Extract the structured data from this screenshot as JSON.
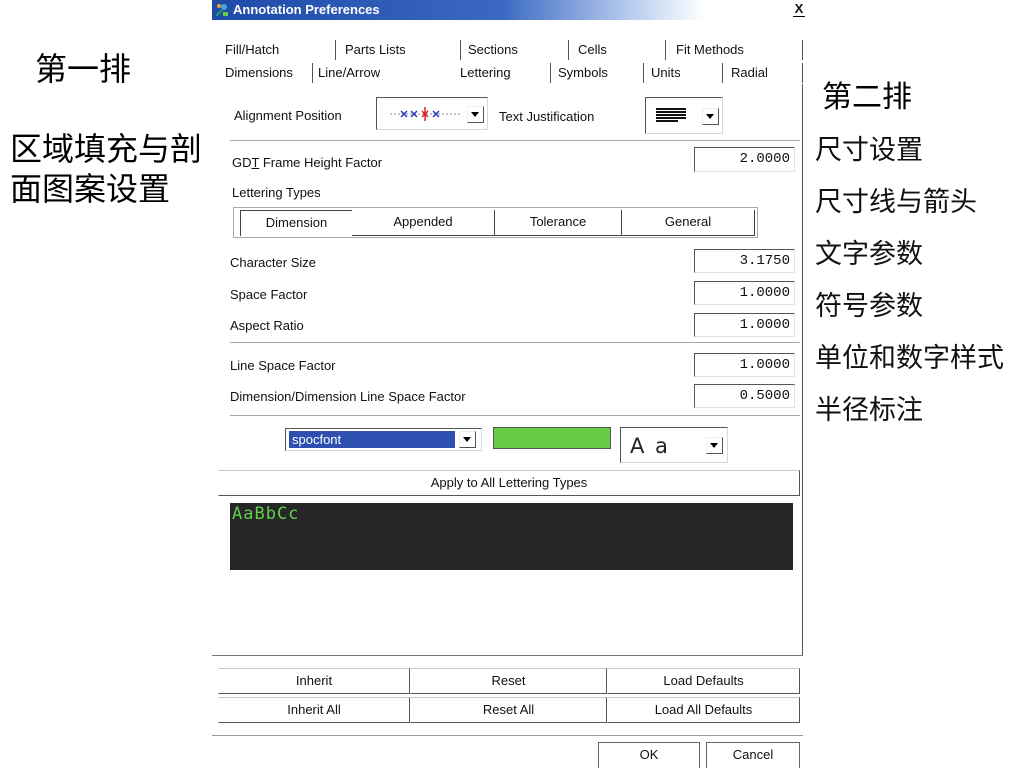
{
  "annotations": {
    "row1": "第一排",
    "fill_hatch": [
      "区域填充与剖",
      "面图案设置"
    ],
    "row2": "第二排",
    "row2_items": [
      "尺寸设置",
      "尺寸线与箭头",
      "文字参数",
      "符号参数",
      "单位和数字样式",
      "半径标注"
    ]
  },
  "window": {
    "title": "Annotation Preferences",
    "icon": "annotation-preferences-icon",
    "close_label": "X",
    "title_color": "#1e4aa8"
  },
  "tabs": {
    "row1": [
      {
        "label": "Fill/Hatch",
        "selected": false
      },
      {
        "label": "Parts Lists",
        "selected": false
      },
      {
        "label": "Sections",
        "selected": false
      },
      {
        "label": "Cells",
        "selected": false
      },
      {
        "label": "Fit Methods",
        "selected": false
      }
    ],
    "row2": [
      {
        "label": "Dimensions",
        "selected": false
      },
      {
        "label": "Line/Arrow",
        "selected": false
      },
      {
        "label": "Lettering",
        "selected": true
      },
      {
        "label": "Symbols",
        "selected": false
      },
      {
        "label": "Units",
        "selected": false
      },
      {
        "label": "Radial",
        "selected": false
      }
    ]
  },
  "lettering": {
    "alignment_position": {
      "label": "Alignment Position",
      "value_icon": "center-cross-alignment-icon"
    },
    "text_justification": {
      "label": "Text Justification",
      "value_icon": "left-justify-icon"
    },
    "gdt_frame_height": {
      "label_prefix": "GD",
      "label_underlined": "T",
      "label_suffix": " Frame Height Factor",
      "value": "2.0000"
    },
    "types": {
      "label": "Lettering Types",
      "options": [
        {
          "label": "Dimension",
          "selected": true
        },
        {
          "label": "Appended",
          "selected": false
        },
        {
          "label": "Tolerance",
          "selected": false
        },
        {
          "label": "General",
          "selected": false
        }
      ]
    },
    "character_size": {
      "label": "Character Size",
      "value": "3.1750"
    },
    "space_factor": {
      "label": "Space Factor",
      "value": "1.0000"
    },
    "aspect_ratio": {
      "label": "Aspect Ratio",
      "value": "1.0000"
    },
    "line_space_factor": {
      "label": "Line Space Factor",
      "value": "1.0000"
    },
    "dim_line_space_factor": {
      "label": "Dimension/Dimension Line Space Factor",
      "value": "0.5000"
    },
    "font": {
      "value": "spocfont",
      "highlight_color": "#2f4fb0"
    },
    "color": "#66cc44",
    "case_style": {
      "value": "A a"
    },
    "apply_all_label": "Apply to All Lettering Types",
    "preview": {
      "text": "AaBbCc",
      "background": "#262626",
      "text_color": "#5fd04a"
    }
  },
  "buttons": {
    "row1": [
      "Inherit",
      "Reset",
      "Load Defaults"
    ],
    "row2": [
      "Inherit All",
      "Reset All",
      "Load All Defaults"
    ]
  },
  "dialog_buttons": {
    "ok": "OK",
    "cancel": "Cancel"
  }
}
